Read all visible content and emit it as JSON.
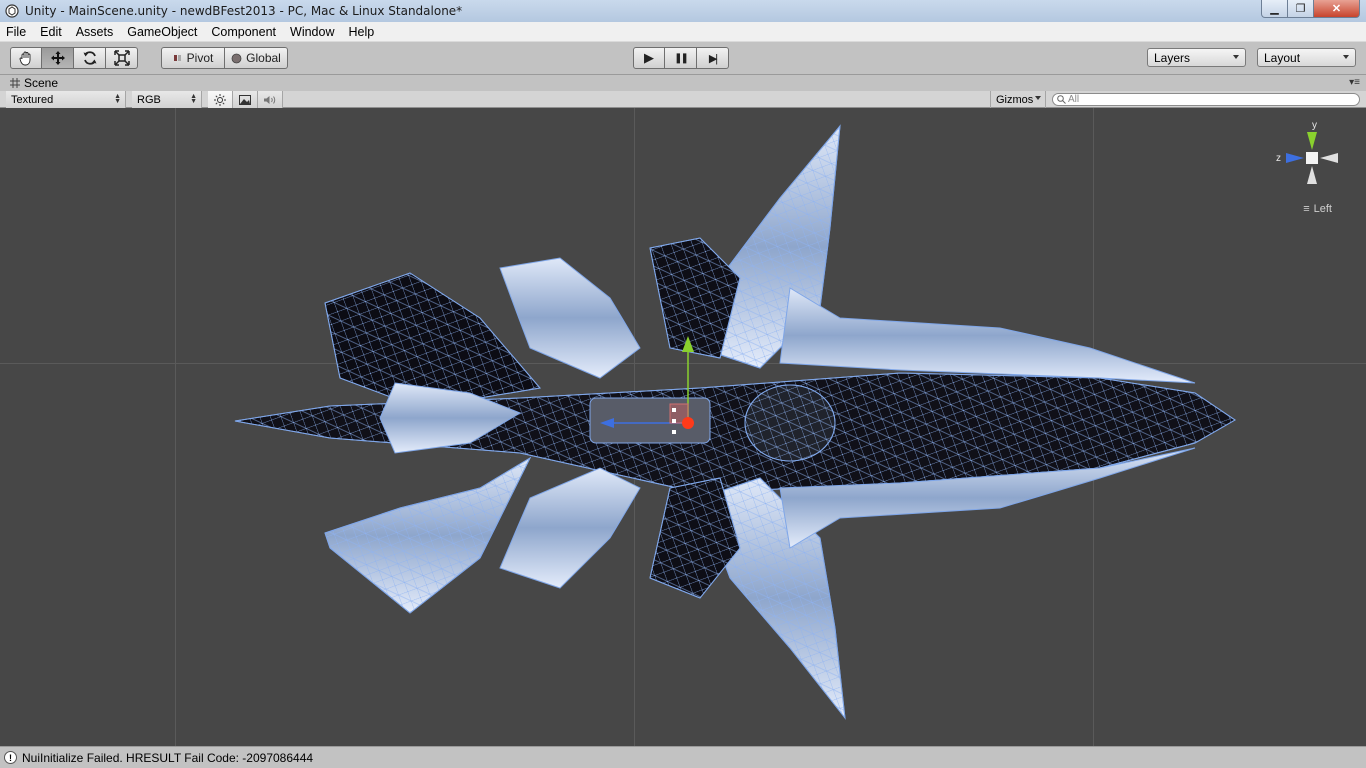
{
  "window": {
    "title": "Unity - MainScene.unity - newdBFest2013 - PC, Mac & Linux Standalone*",
    "controls": {
      "minimize": "▁",
      "maximize": "❐",
      "close": "✕"
    }
  },
  "menubar": {
    "items": [
      "File",
      "Edit",
      "Assets",
      "GameObject",
      "Component",
      "Window",
      "Help"
    ]
  },
  "toolbar": {
    "transform_tools": [
      "hand-icon",
      "move-icon",
      "rotate-icon",
      "scale-icon"
    ],
    "active_tool": "move",
    "pivot_label": "Pivot",
    "global_label": "Global",
    "play_controls": {
      "play": "▶",
      "pause": "❚❚",
      "step": "▶|"
    },
    "layers_label": "Layers",
    "layout_label": "Layout"
  },
  "scene_panel": {
    "tab_label": "Scene",
    "render_mode": "Textured",
    "color_mode": "RGB",
    "toggles": [
      "sun-icon",
      "image-icon",
      "audio-icon"
    ],
    "gizmos_label": "Gizmos",
    "search_placeholder": "All"
  },
  "viewport": {
    "background_color": "#474747",
    "mesh_color": "#7fa6e8",
    "orientation": {
      "y_label": "y",
      "z_label": "z",
      "view_label": "Left"
    }
  },
  "statusbar": {
    "message": "NuiInitialize Failed. HRESULT Fail Code: -2097086444"
  }
}
